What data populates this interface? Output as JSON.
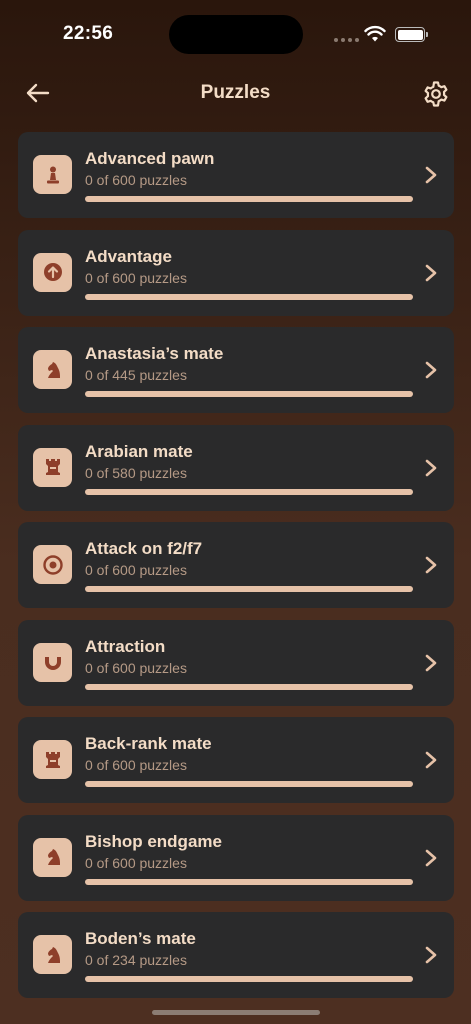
{
  "status_bar": {
    "time": "22:56"
  },
  "header": {
    "title": "Puzzles",
    "back_icon": "arrow-left-icon",
    "settings_icon": "gear-icon"
  },
  "colors": {
    "accent": "#e6c2a8",
    "icon_glyph": "#8e3f2a",
    "card": "#2a2a2b"
  },
  "themes": [
    {
      "title": "Advanced pawn",
      "subtitle": "0 of 600 puzzles",
      "icon": "pawn-icon",
      "progress": 0
    },
    {
      "title": "Advantage",
      "subtitle": "0 of 600 puzzles",
      "icon": "arrow-up-circle-icon",
      "progress": 0
    },
    {
      "title": "Anastasia’s mate",
      "subtitle": "0 of 445 puzzles",
      "icon": "knight-icon",
      "progress": 0
    },
    {
      "title": "Arabian mate",
      "subtitle": "0 of 580 puzzles",
      "icon": "rook-icon",
      "progress": 0
    },
    {
      "title": "Attack on f2/f7",
      "subtitle": "0 of 600 puzzles",
      "icon": "target-icon",
      "progress": 0
    },
    {
      "title": "Attraction",
      "subtitle": "0 of 600 puzzles",
      "icon": "magnet-icon",
      "progress": 0
    },
    {
      "title": "Back-rank mate",
      "subtitle": "0 of 600 puzzles",
      "icon": "rook-icon",
      "progress": 0
    },
    {
      "title": "Bishop endgame",
      "subtitle": "0 of 600 puzzles",
      "icon": "knight-icon",
      "progress": 0
    },
    {
      "title": "Boden’s mate",
      "subtitle": "0 of 234 puzzles",
      "icon": "knight-icon",
      "progress": 0
    }
  ]
}
